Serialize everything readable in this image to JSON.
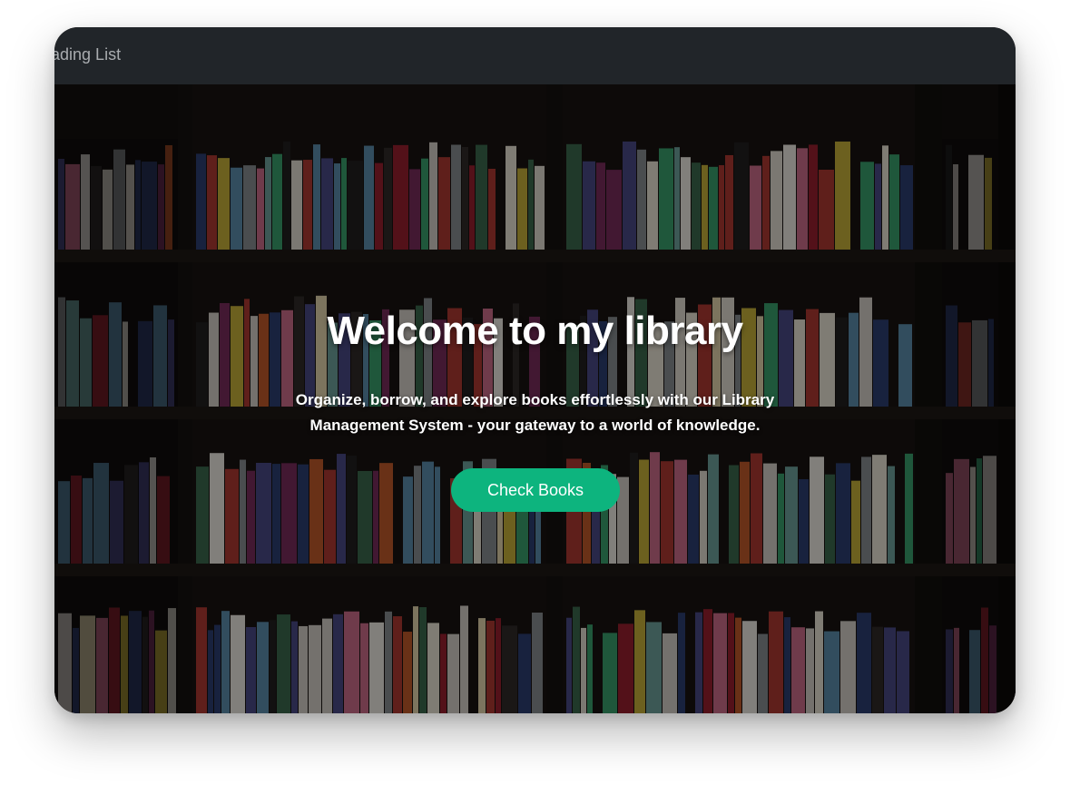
{
  "navbar": {
    "brand": "Reading List"
  },
  "hero": {
    "title": "Welcome to my library",
    "subtitle": "Organize, borrow, and explore books effortlessly with our Library Management System - your gateway to a world of knowledge.",
    "cta_label": "Check Books"
  },
  "colors": {
    "navbar_bg": "#212529",
    "accent": "#0db47e",
    "text": "#ffffff"
  },
  "background": {
    "image": "bookshelf-photo"
  }
}
